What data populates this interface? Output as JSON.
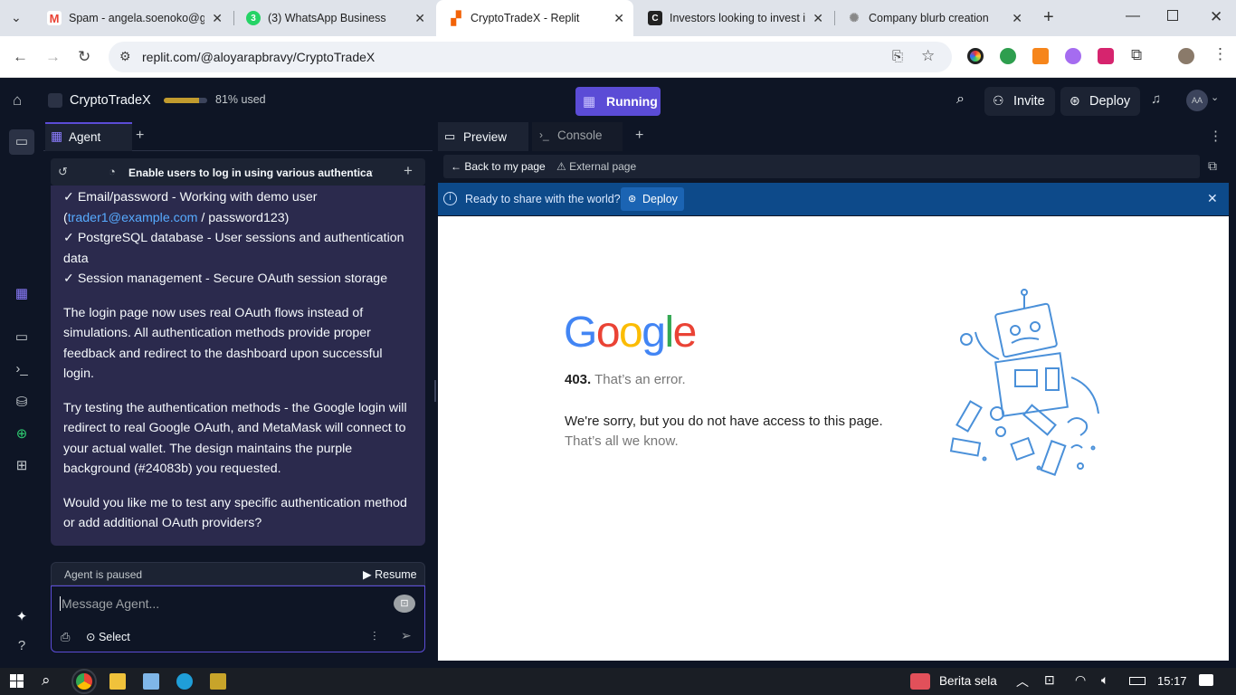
{
  "browser": {
    "tabs": [
      {
        "title": "Spam - angela.soenoko@gm",
        "icon": "gmail-icon",
        "active": false
      },
      {
        "title": "(3) WhatsApp Business",
        "icon": "whatsapp-icon",
        "active": false
      },
      {
        "title": "CryptoTradeX - Replit",
        "icon": "replit-icon",
        "active": true
      },
      {
        "title": "Investors looking to invest ir",
        "icon": "c-icon",
        "active": false
      },
      {
        "title": "Company blurb creation",
        "icon": "openai-icon",
        "active": false
      }
    ],
    "url": "replit.com/@aloyarapbravy/CryptoTradeX"
  },
  "topbar": {
    "app_name": "CryptoTradeX",
    "usage_fraction": 0.81,
    "usage_label": "81% used",
    "run_status": "Running",
    "invite_label": "Invite",
    "deploy_label": "Deploy",
    "avatar_initials": "AA"
  },
  "agent": {
    "tab_label": "Agent",
    "thread_title": "Enable users to log in using various authenticati...",
    "message": {
      "line1": "✓ Email/password - Working with demo user",
      "line2_pre": "(",
      "line2_link": "trader1@example.com",
      "line2_post": " / password123)",
      "line3": "✓ PostgreSQL database - User sessions and authentication data",
      "line4": "✓ Session management - Secure OAuth session storage",
      "para2": "The login page now uses real OAuth flows instead of simulations. All authentication methods provide proper feedback and redirect to the dashboard upon successful login.",
      "para3": "Try testing the authentication methods - the Google login will redirect to real Google OAuth, and MetaMask will connect to your actual wallet. The design maintains the purple background (#24083b) you requested.",
      "para4": "Would you like me to test any specific authentication method or add additional OAuth providers?"
    },
    "paused_label": "Agent is paused",
    "resume_label": "Resume",
    "input_placeholder": "Message Agent...",
    "select_label": "Select"
  },
  "preview": {
    "tab_preview": "Preview",
    "tab_console": "Console",
    "back_label": "Back to my page",
    "external_label": "External page",
    "banner_text": "Ready to share with the world?",
    "banner_deploy": "Deploy",
    "google_logo": [
      "G",
      "o",
      "o",
      "g",
      "l",
      "e"
    ],
    "logo_colors": [
      "#4285f4",
      "#ea4335",
      "#fbbc05",
      "#4285f4",
      "#34a853",
      "#ea4335"
    ],
    "error_code": "403.",
    "error_title": "That’s an error.",
    "error_msg": "We're sorry, but you do not have access to this page.",
    "error_sub": "That’s all we know."
  },
  "taskbar": {
    "news_label": "Berita sela",
    "time": "15:17"
  },
  "colors": {
    "accent": "#5b4cd6",
    "panel": "#1c2333",
    "bg": "#0e1525",
    "message_bg": "#2b2a4d",
    "banner": "#0d4a8a"
  }
}
